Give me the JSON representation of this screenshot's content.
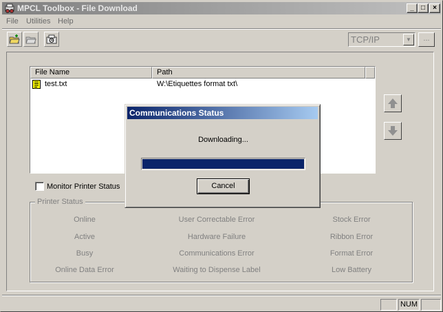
{
  "window": {
    "title": "MPCL Toolbox - File Download"
  },
  "caption_buttons": {
    "minimize": "_",
    "maximize": "□",
    "close": "×"
  },
  "menu": [
    "File",
    "Utilities",
    "Help"
  ],
  "toolbar": {
    "icons": [
      "open-add-folder-icon",
      "open-folder-icon",
      "printer-settings-icon"
    ],
    "connection": {
      "selected": "TCP/IP"
    },
    "browse_label": "..."
  },
  "file_list": {
    "columns": [
      "File Name",
      "Path"
    ],
    "rows": [
      {
        "name": "test.txt",
        "path": "W:\\Etiquettes format txt\\"
      }
    ]
  },
  "monitor_label": "Monitor Printer Status",
  "printer_status": {
    "legend": "Printer Status",
    "col1": [
      "Online",
      "Active",
      "Busy",
      "Online Data Error"
    ],
    "col2": [
      "User Correctable Error",
      "Hardware Failure",
      "Communications Error",
      "Waiting to Dispense Label"
    ],
    "col3": [
      "Stock Error",
      "Ribbon Error",
      "Format Error",
      "Low Battery"
    ]
  },
  "statusbar": {
    "num": "NUM"
  },
  "dialog": {
    "title": "Communications Status",
    "message": "Downloading...",
    "progress_fraction": 1.0,
    "cancel_label": "Cancel"
  }
}
